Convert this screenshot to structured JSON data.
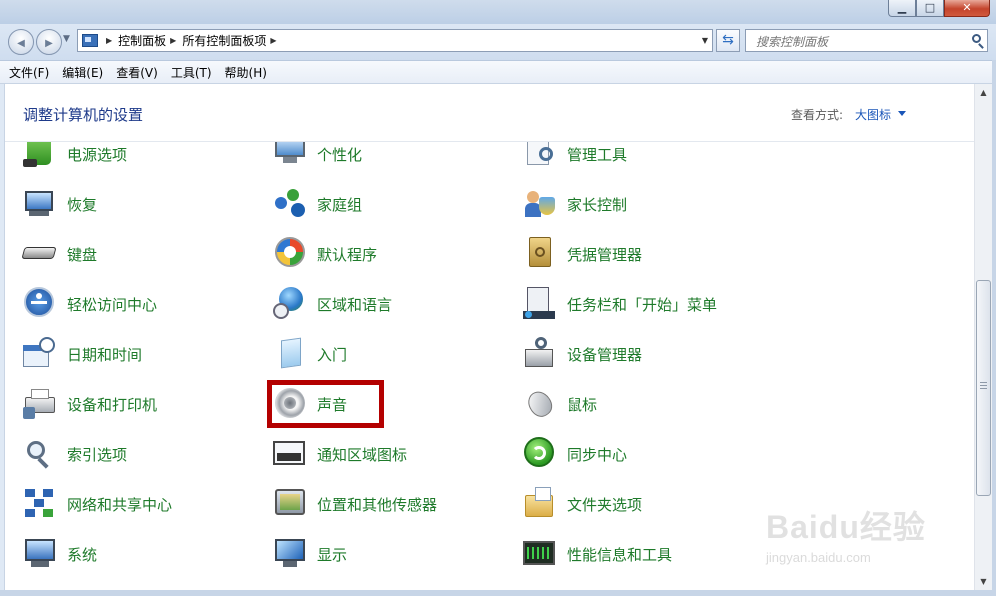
{
  "window": {
    "minimize_glyph": "▁",
    "maximize_glyph": "□",
    "close_glyph": "✕"
  },
  "nav": {
    "back_glyph": "◀",
    "forward_glyph": "▶",
    "crumbs": [
      "控制面板",
      "所有控制面板项"
    ],
    "crumb_sep_glyph": "▶",
    "dropdown_glyph": "▼",
    "refresh_glyph": "⇆",
    "search_placeholder": "搜索控制面板"
  },
  "menu": [
    "文件(F)",
    "编辑(E)",
    "查看(V)",
    "工具(T)",
    "帮助(H)"
  ],
  "content": {
    "title": "调整计算机的设置",
    "view_by_label": "查看方式:",
    "view_by_value": "大图标"
  },
  "items": [
    {
      "label": "电源选项",
      "icon": "power-options-icon",
      "col": 0,
      "row": 0
    },
    {
      "label": "个性化",
      "icon": "personalization-icon",
      "col": 1,
      "row": 0
    },
    {
      "label": "管理工具",
      "icon": "admin-tools-icon",
      "col": 2,
      "row": 0
    },
    {
      "label": "恢复",
      "icon": "recovery-icon",
      "col": 0,
      "row": 1
    },
    {
      "label": "家庭组",
      "icon": "homegroup-icon",
      "col": 1,
      "row": 1
    },
    {
      "label": "家长控制",
      "icon": "parental-controls-icon",
      "col": 2,
      "row": 1
    },
    {
      "label": "键盘",
      "icon": "keyboard-icon",
      "col": 0,
      "row": 2
    },
    {
      "label": "默认程序",
      "icon": "default-programs-icon",
      "col": 1,
      "row": 2
    },
    {
      "label": "凭据管理器",
      "icon": "credential-manager-icon",
      "col": 2,
      "row": 2
    },
    {
      "label": "轻松访问中心",
      "icon": "ease-of-access-icon",
      "col": 0,
      "row": 3
    },
    {
      "label": "区域和语言",
      "icon": "region-language-icon",
      "col": 1,
      "row": 3
    },
    {
      "label": "任务栏和「开始」菜单",
      "icon": "taskbar-start-menu-icon",
      "col": 2,
      "row": 3
    },
    {
      "label": "日期和时间",
      "icon": "date-time-icon",
      "col": 0,
      "row": 4
    },
    {
      "label": "入门",
      "icon": "getting-started-icon",
      "col": 1,
      "row": 4
    },
    {
      "label": "设备管理器",
      "icon": "device-manager-icon",
      "col": 2,
      "row": 4
    },
    {
      "label": "设备和打印机",
      "icon": "devices-printers-icon",
      "col": 0,
      "row": 5
    },
    {
      "label": "声音",
      "icon": "sound-icon",
      "col": 1,
      "row": 5
    },
    {
      "label": "鼠标",
      "icon": "mouse-icon",
      "col": 2,
      "row": 5
    },
    {
      "label": "索引选项",
      "icon": "indexing-options-icon",
      "col": 0,
      "row": 6
    },
    {
      "label": "通知区域图标",
      "icon": "notification-area-icon",
      "col": 1,
      "row": 6
    },
    {
      "label": "同步中心",
      "icon": "sync-center-icon",
      "col": 2,
      "row": 6
    },
    {
      "label": "网络和共享中心",
      "icon": "network-sharing-icon",
      "col": 0,
      "row": 7
    },
    {
      "label": "位置和其他传感器",
      "icon": "location-sensors-icon",
      "col": 1,
      "row": 7
    },
    {
      "label": "文件夹选项",
      "icon": "folder-options-icon",
      "col": 2,
      "row": 7
    },
    {
      "label": "系统",
      "icon": "system-icon",
      "col": 0,
      "row": 8
    },
    {
      "label": "显示",
      "icon": "display-icon",
      "col": 1,
      "row": 8
    },
    {
      "label": "性能信息和工具",
      "icon": "performance-tools-icon",
      "col": 2,
      "row": 8
    }
  ],
  "highlighted_item": "声音",
  "highlight_color": "#b40000",
  "label_color": "#1e7a2a",
  "watermark": {
    "text": "Baidu经验",
    "sub": "jingyan.baidu.com"
  }
}
